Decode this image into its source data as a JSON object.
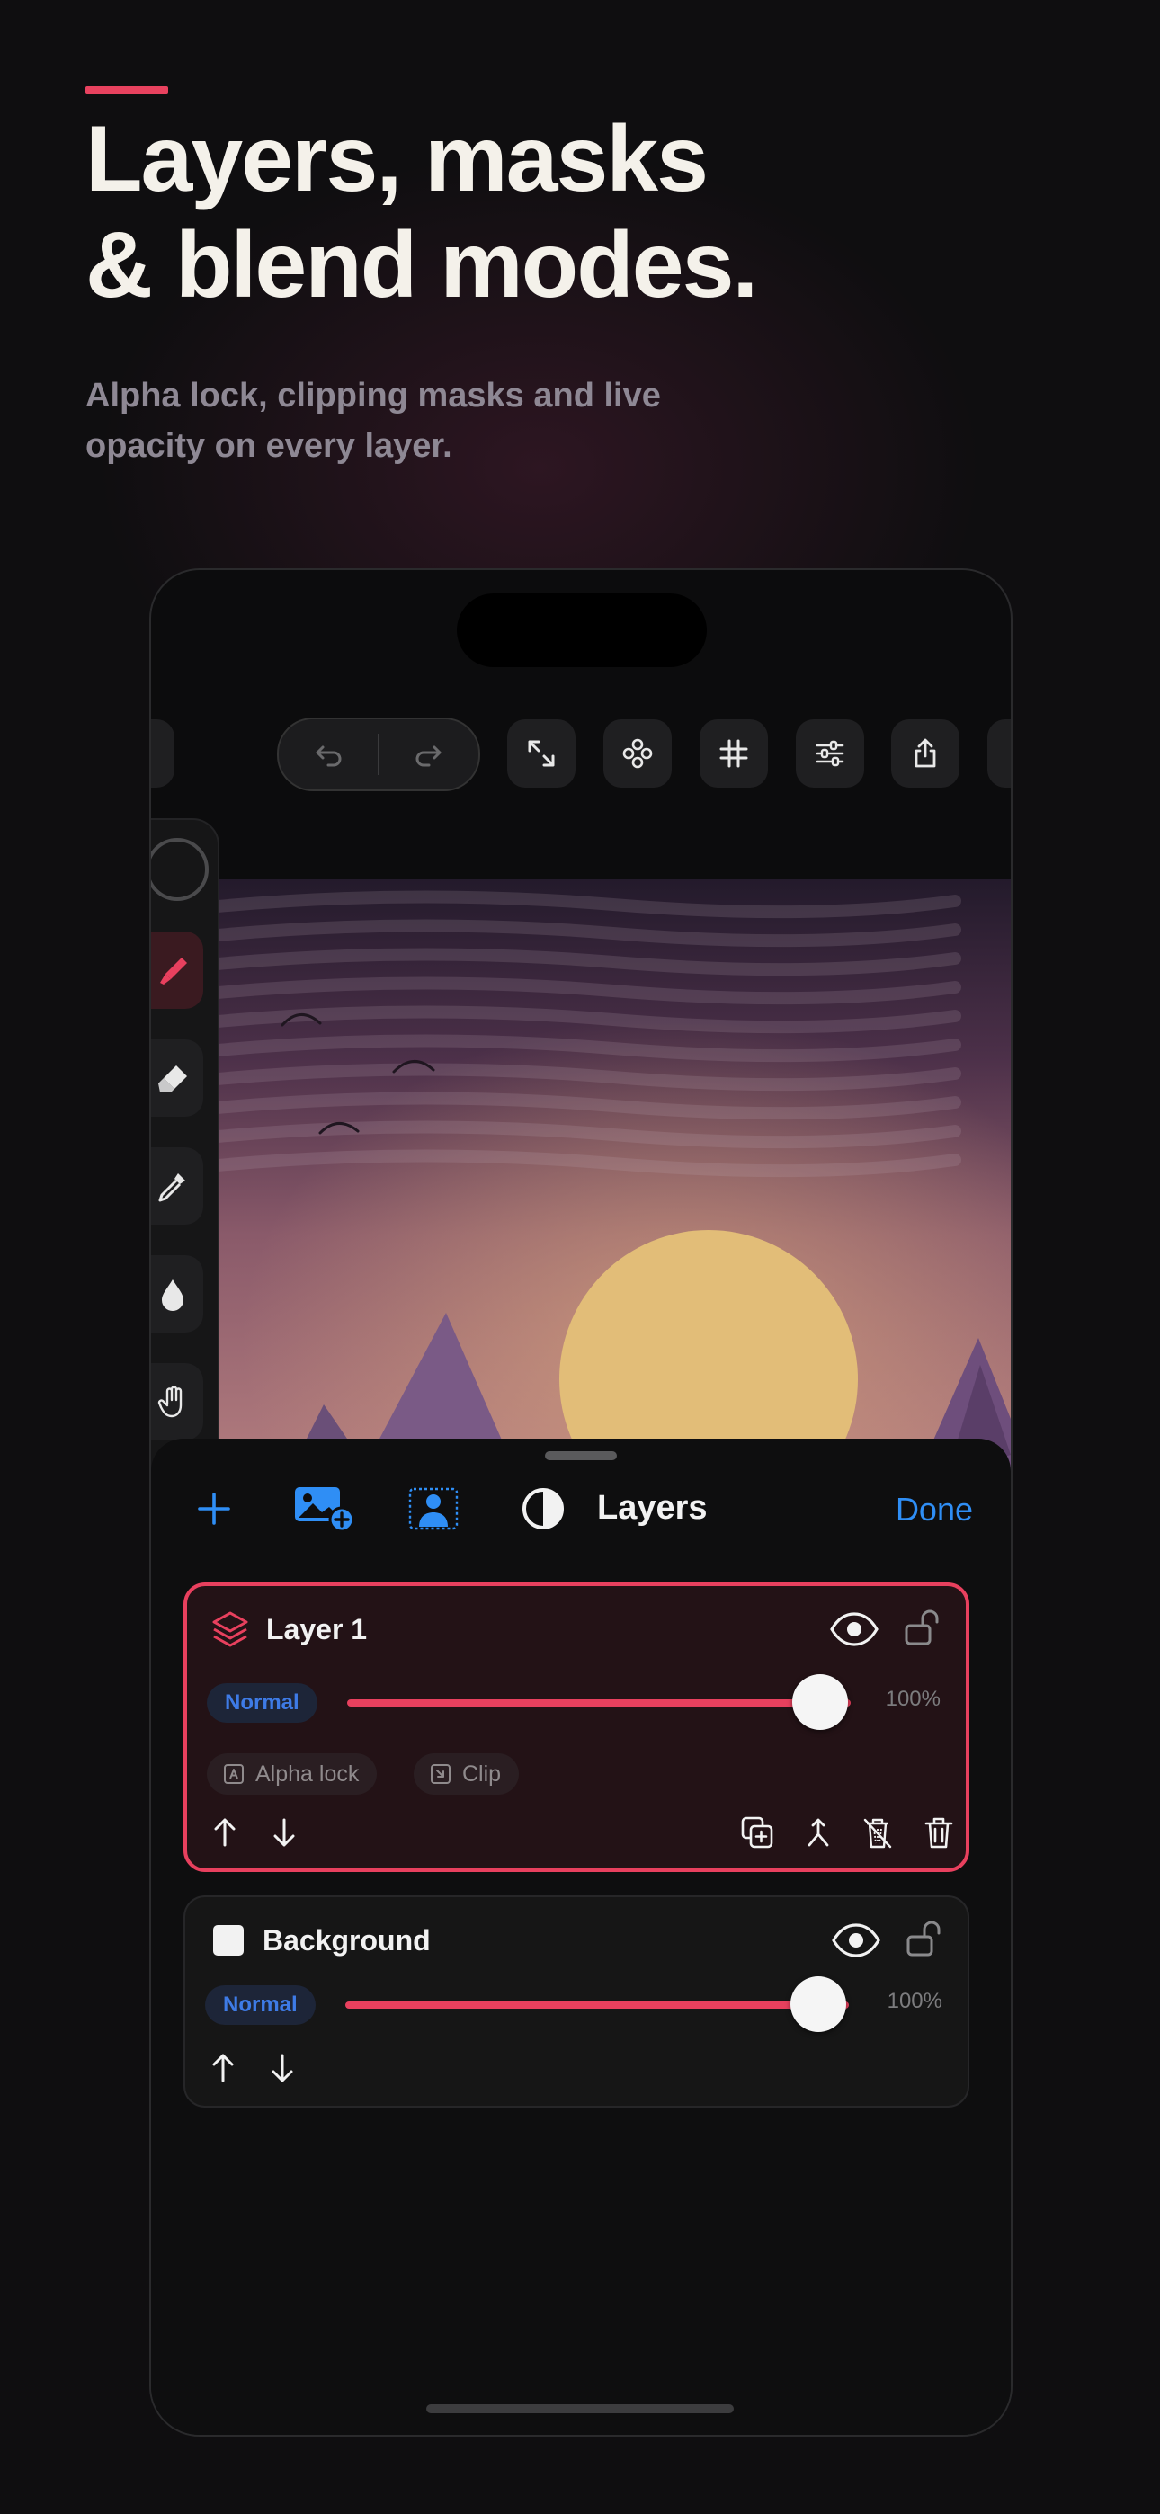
{
  "promo": {
    "headline_line1": "Layers, masks",
    "headline_line2": "& blend modes.",
    "subhead": "Alpha lock, clipping masks and live opacity on every layer."
  },
  "colors": {
    "accent": "#e8425f",
    "link_blue": "#2f8ef5",
    "background": "#0f0e10"
  },
  "toolbar": {
    "icons": [
      "undo-icon",
      "redo-icon",
      "fullscreen-icon",
      "reference-icon",
      "grid-icon",
      "adjustments-icon",
      "share-icon",
      "settings-icon"
    ]
  },
  "toolrail": {
    "tools": [
      "color-swatch",
      "brush-icon",
      "eraser-icon",
      "eyedropper-icon",
      "smudge-icon",
      "hand-icon"
    ],
    "active_tool": "brush-icon"
  },
  "layers_panel": {
    "title": "Layers",
    "done_label": "Done",
    "header_icons": [
      "add-layer-icon",
      "import-image-icon",
      "subject-mask-icon",
      "contrast-icon"
    ],
    "layers": [
      {
        "name": "Layer 1",
        "selected": true,
        "blend_mode": "Normal",
        "opacity_label": "100%",
        "opacity": 1.0,
        "options": [
          "Alpha lock",
          "Clip"
        ],
        "actions": [
          "duplicate-icon",
          "merge-down-icon",
          "clear-icon",
          "delete-icon"
        ]
      },
      {
        "name": "Background",
        "selected": false,
        "blend_mode": "Normal",
        "opacity_label": "100%",
        "opacity": 1.0
      }
    ]
  }
}
